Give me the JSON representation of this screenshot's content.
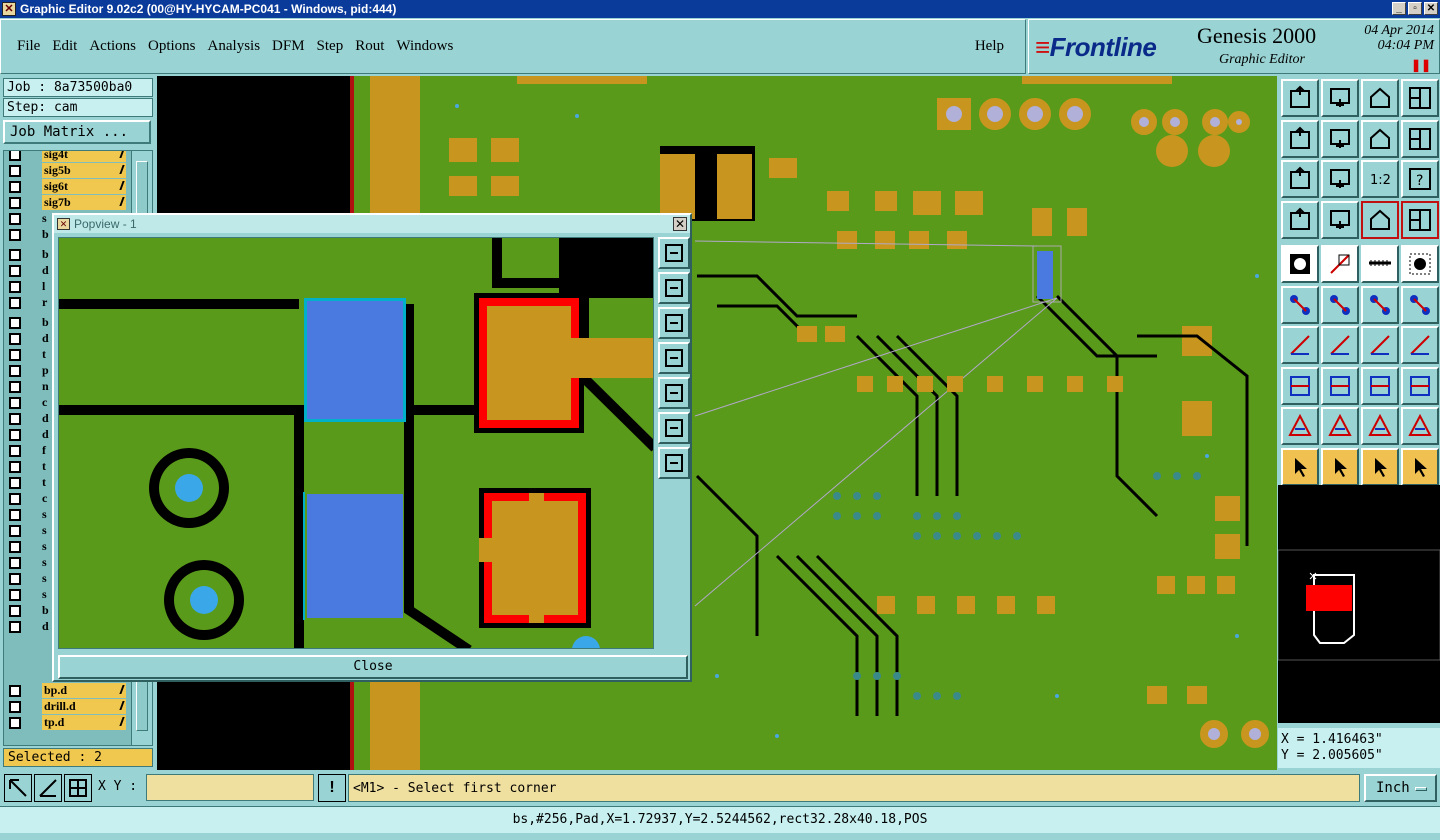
{
  "window": {
    "title": "Graphic Editor 9.02c2 (00@HY-HYCAM-PC041 - Windows, pid:444)"
  },
  "menu": {
    "items": [
      "File",
      "Edit",
      "Actions",
      "Options",
      "Analysis",
      "DFM",
      "Step",
      "Rout",
      "Windows"
    ],
    "help": "Help"
  },
  "brand": {
    "logo": "Frontline",
    "product": "Genesis 2000",
    "subtitle": "Graphic Editor",
    "date": "04 Apr 2014",
    "time": "04:04 PM"
  },
  "job": {
    "job_label": "Job : 8a73500ba0",
    "step_label": "Step: cam",
    "matrix_button": "Job Matrix ..."
  },
  "layers": {
    "named": [
      {
        "name": "sig4t"
      },
      {
        "name": "sig5b"
      },
      {
        "name": "sig6t"
      },
      {
        "name": "sig7b"
      }
    ],
    "bottom": [
      {
        "name": "bp.d"
      },
      {
        "name": "drill.d"
      },
      {
        "name": "tp.d"
      }
    ],
    "partial_letters": [
      "s",
      "b",
      "b",
      "d",
      "l",
      "r",
      "b",
      "d",
      "t",
      "p",
      "n",
      "c",
      "d",
      "d",
      "f",
      "t",
      "t",
      "c",
      "s",
      "s",
      "s",
      "s",
      "s",
      "s",
      "b",
      "d"
    ]
  },
  "selected": "Selected : 2",
  "popup": {
    "title": "Popview - 1",
    "close_label": "Close"
  },
  "coords": {
    "x": "X = 1.416463\"",
    "y": "Y = 2.005605\""
  },
  "bottom": {
    "xy_label": "X Y :",
    "xy_value": "",
    "prompt": "<M1> - Select first corner",
    "units": "Inch"
  },
  "status": "bs,#256,Pad,X=1.72937,Y=2.5244562,rect32.28x40.18,POS",
  "colors": {
    "board": "#5a9a1a",
    "pad": "#c8961e",
    "selection": "#4a7ae0",
    "titlebar": "#0a3a9a"
  }
}
